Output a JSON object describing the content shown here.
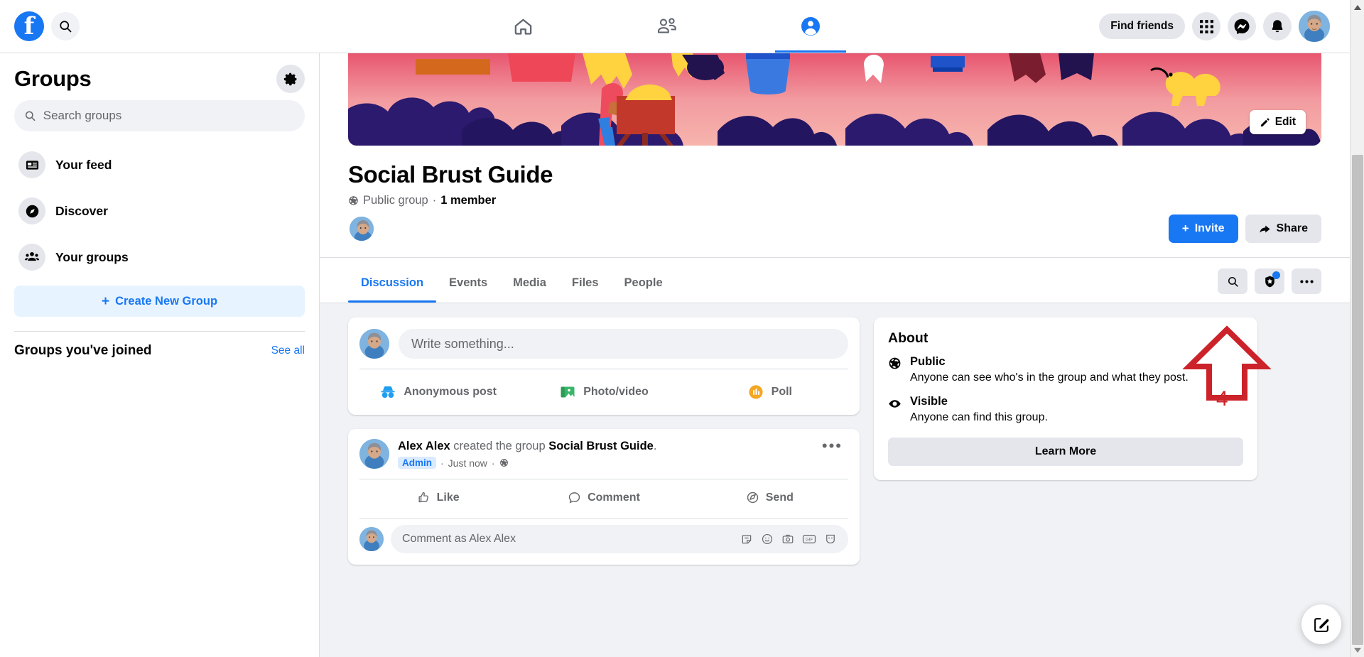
{
  "colors": {
    "brand": "#1877f2",
    "annotation": "#cc2229",
    "grey_btn": "#e4e6eb",
    "page_bg": "#f0f2f5",
    "muted_text": "#65676b"
  },
  "topbar": {
    "logo_icon": "facebook-logo-icon",
    "search_icon": "search-icon",
    "nav": [
      {
        "name": "home",
        "icon": "home-icon",
        "active": false
      },
      {
        "name": "friends",
        "icon": "friends-icon",
        "active": false
      },
      {
        "name": "groups",
        "icon": "groups-icon",
        "active": true
      }
    ],
    "find_friends_label": "Find friends",
    "menu_icon": "grid-menu-icon",
    "messenger_icon": "messenger-icon",
    "notifications_icon": "bell-icon",
    "account_avatar": "user-avatar"
  },
  "sidebar": {
    "title": "Groups",
    "settings_icon": "gear-icon",
    "search": {
      "placeholder": "Search groups",
      "value": "",
      "icon": "search-icon"
    },
    "items": [
      {
        "label": "Your feed",
        "icon": "newspaper-icon"
      },
      {
        "label": "Discover",
        "icon": "compass-icon"
      },
      {
        "label": "Your groups",
        "icon": "people-group-icon"
      }
    ],
    "create_button": {
      "label": "Create New Group",
      "icon": "plus-icon"
    },
    "joined_heading": "Groups you've joined",
    "see_all_label": "See all"
  },
  "group": {
    "cover_edit_label": "Edit",
    "cover_edit_icon": "pencil-icon",
    "name": "Social Brust Guide",
    "privacy_icon": "globe-icon",
    "meta_privacy": "Public group",
    "meta_separator": "·",
    "meta_members": "1 member",
    "member_avatar": "member-avatar",
    "invite_label": "Invite",
    "invite_icon": "plus-icon",
    "share_label": "Share",
    "share_icon": "share-arrow-icon",
    "tabs": [
      {
        "label": "Discussion",
        "active": true
      },
      {
        "label": "Events",
        "active": false
      },
      {
        "label": "Media",
        "active": false
      },
      {
        "label": "Files",
        "active": false
      },
      {
        "label": "People",
        "active": false
      }
    ],
    "tab_actions": [
      {
        "name": "search-posts-button",
        "icon": "search-icon",
        "badge": false
      },
      {
        "name": "admin-tools-button",
        "icon": "shield-badge-icon",
        "badge": true
      },
      {
        "name": "more-options-button",
        "icon": "ellipsis-icon",
        "badge": false
      }
    ]
  },
  "composer": {
    "avatar": "user-avatar",
    "placeholder": "Write something...",
    "value": "",
    "actions": [
      {
        "label": "Anonymous post",
        "icon": "incognito-icon"
      },
      {
        "label": "Photo/video",
        "icon": "photo-video-icon"
      },
      {
        "label": "Poll",
        "icon": "poll-icon"
      }
    ]
  },
  "post": {
    "avatar": "user-avatar",
    "author": "Alex Alex",
    "action_text": "created the group",
    "target": "Social Brust Guide",
    "period": ".",
    "badge": "Admin",
    "dot1": "·",
    "timestamp": "Just now",
    "dot2": "·",
    "audience_icon": "globe-icon",
    "more_icon": "ellipsis-icon",
    "more_glyph": "•••",
    "actions": [
      {
        "label": "Like",
        "icon": "thumbs-up-icon"
      },
      {
        "label": "Comment",
        "icon": "comment-bubble-icon"
      },
      {
        "label": "Send",
        "icon": "send-icon"
      }
    ],
    "comment": {
      "avatar": "user-avatar",
      "placeholder": "Comment as Alex Alex",
      "value": "",
      "icons": [
        "sticker-icon",
        "emoji-icon",
        "camera-icon",
        "gif-icon",
        "avatar-sticker-icon"
      ],
      "gif_label": "GIF"
    }
  },
  "about": {
    "title": "About",
    "items": [
      {
        "icon": "globe-icon",
        "heading": "Public",
        "body": "Anyone can see who's in the group and what they post."
      },
      {
        "icon": "eye-icon",
        "heading": "Visible",
        "body": "Anyone can find this group."
      }
    ],
    "learn_more_label": "Learn More"
  },
  "fab": {
    "name": "create-post-fab",
    "icon": "compose-pencil-icon"
  },
  "annotation": {
    "number": "4",
    "icon": "up-arrow-annotation",
    "color": "#cc2229"
  },
  "scrollbar": {
    "up_icon": "scroll-up-arrow-icon",
    "down_icon": "scroll-down-arrow-icon"
  }
}
